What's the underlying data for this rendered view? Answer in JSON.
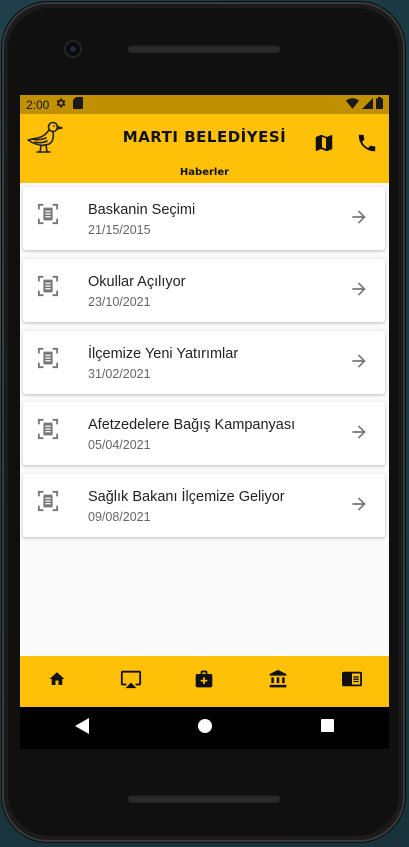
{
  "status_bar": {
    "time": "2:00",
    "icons": [
      "settings-icon",
      "sd-card-icon",
      "wifi-icon",
      "signal-icon",
      "battery-icon"
    ]
  },
  "app_bar": {
    "title": "MARTI BELEDİYESİ",
    "subtitle": "Haberler",
    "logo": "seagull-logo",
    "actions": [
      "map-icon",
      "phone-icon"
    ],
    "color": "#ffc107"
  },
  "news": [
    {
      "title": "Baskanin Seçimi",
      "date": "21/15/2015"
    },
    {
      "title": "Okullar Açılıyor",
      "date": "23/10/2021"
    },
    {
      "title": "İlçemize Yeni Yatırımlar",
      "date": "31/02/2021"
    },
    {
      "title": "Afetzedelere Bağış Kampanyası",
      "date": "05/04/2021"
    },
    {
      "title": "Sağlık Bakanı İlçemize Geliyor",
      "date": "09/08/2021"
    }
  ],
  "bottom_nav": [
    "home-icon",
    "airplay-icon",
    "medical-icon",
    "bank-icon",
    "news-icon"
  ],
  "system_nav": [
    "back-icon",
    "home-circle-icon",
    "recents-icon"
  ]
}
